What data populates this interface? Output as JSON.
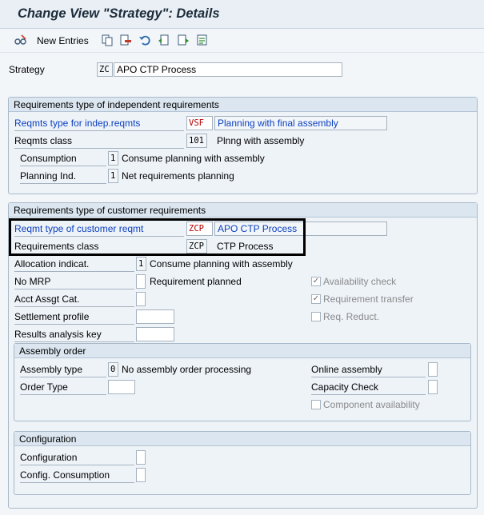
{
  "window": {
    "title": "Change View \"Strategy\": Details"
  },
  "toolbar": {
    "new_entries_label": "New Entries",
    "icons": [
      "glasses-edit-icon",
      "copy-icon",
      "delete-icon",
      "undo-icon",
      "prev-entry-icon",
      "next-entry-icon",
      "select-icon"
    ]
  },
  "strategy": {
    "label": "Strategy",
    "code": "ZC",
    "description": "APO CTP Process"
  },
  "indep": {
    "group_title": "Requirements type of independent requirements",
    "reqmts_type_label": "Reqmts type for indep.reqmts",
    "reqmts_type_value": "VSF",
    "reqmts_type_desc": "Planning with final assembly",
    "reqmts_class_label": "Reqmts class",
    "reqmts_class_value": "101",
    "reqmts_class_desc": "Plnng with assembly",
    "consumption_label": "Consumption",
    "consumption_value": "1",
    "consumption_desc": "Consume planning with assembly",
    "planning_ind_label": "Planning Ind.",
    "planning_ind_value": "1",
    "planning_ind_desc": "Net requirements planning"
  },
  "cust": {
    "group_title": "Requirements type of customer requirements",
    "reqmt_type_label": "Reqmt type of customer reqmt",
    "reqmt_type_value": "ZCP",
    "reqmt_type_desc": "APO CTP Process",
    "req_class_label": "Requirements class",
    "req_class_value": "ZCP",
    "req_class_desc": "CTP Process",
    "alloc_label": "Allocation indicat.",
    "alloc_value": "1",
    "alloc_desc": "Consume planning with assembly",
    "no_mrp_label": "No MRP",
    "no_mrp_desc": "Requirement planned",
    "acct_label": "Acct Assgt Cat.",
    "settlement_label": "Settlement profile",
    "results_label": "Results analysis key",
    "availability_check_label": "Availability check",
    "availability_check_checked": true,
    "req_transfer_label": "Requirement transfer",
    "req_transfer_checked": true,
    "req_reduct_label": "Req. Reduct.",
    "req_reduct_checked": false
  },
  "assembly": {
    "group_title": "Assembly order",
    "assembly_type_label": "Assembly type",
    "assembly_type_value": "0",
    "assembly_type_desc": "No assembly order processing",
    "order_type_label": "Order Type",
    "online_assembly_label": "Online assembly",
    "capacity_check_label": "Capacity Check",
    "component_avail_label": "Component availability",
    "component_avail_checked": false
  },
  "config": {
    "group_title": "Configuration",
    "configuration_label": "Configuration",
    "config_consumption_label": "Config. Consumption"
  },
  "colors": {
    "label_blue": "#0a3fbf",
    "header_bg": "#e9eff5",
    "group_bg": "#eef3f8"
  }
}
